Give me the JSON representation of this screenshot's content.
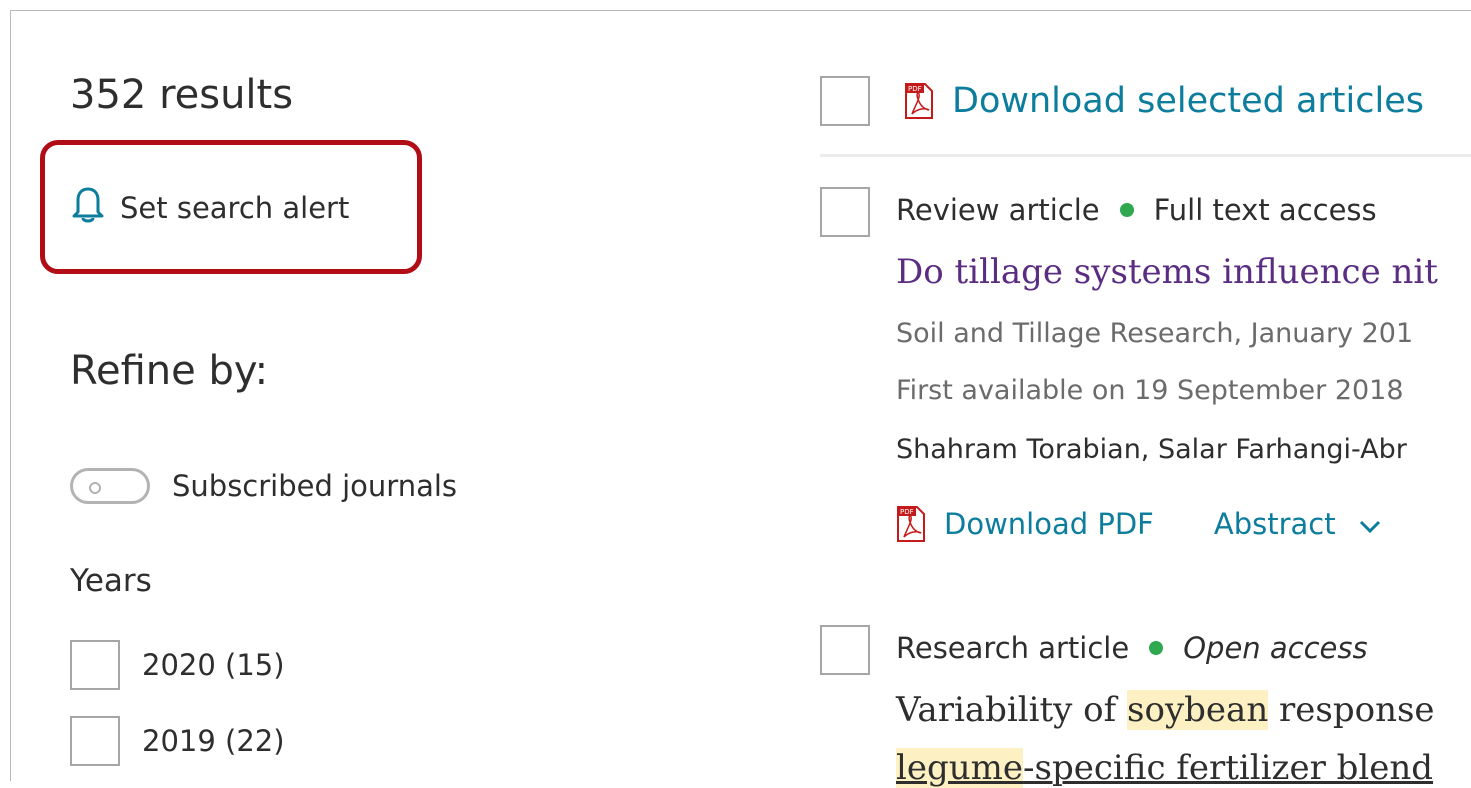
{
  "results": {
    "count_text": "352 results"
  },
  "search_alert": {
    "label": "Set search alert"
  },
  "refine": {
    "title": "Refine by:",
    "subscribed_toggle_label": "Subscribed journals",
    "years_title": "Years",
    "years": [
      {
        "label": "2020 (15)"
      },
      {
        "label": "2019 (22)"
      }
    ]
  },
  "toolbar": {
    "download_selected_label": "Download selected articles"
  },
  "articles": [
    {
      "type": "Review article",
      "access": "Full text access",
      "title": "Do tillage systems influence nit",
      "journal": "Soil and Tillage Research, January 201",
      "available": "First available on 19 September 2018",
      "authors": "Shahram Torabian, Salar Farhangi-Abr",
      "download_pdf_label": "Download PDF",
      "abstract_label": "Abstract"
    },
    {
      "type": "Research article",
      "access": "Open access",
      "title_before": "Variability of ",
      "title_highlight": "soybean",
      "title_after": " response",
      "title_line2_highlight": "legume",
      "title_line2_rest": "-specific fertilizer blend"
    }
  ],
  "colors": {
    "link_blue": "#0c7d9d",
    "visited_title": "#5b2d82",
    "access_dot": "#2fa84f",
    "highlight_box": "#b00d17",
    "term_highlight": "#fdf1c3"
  }
}
